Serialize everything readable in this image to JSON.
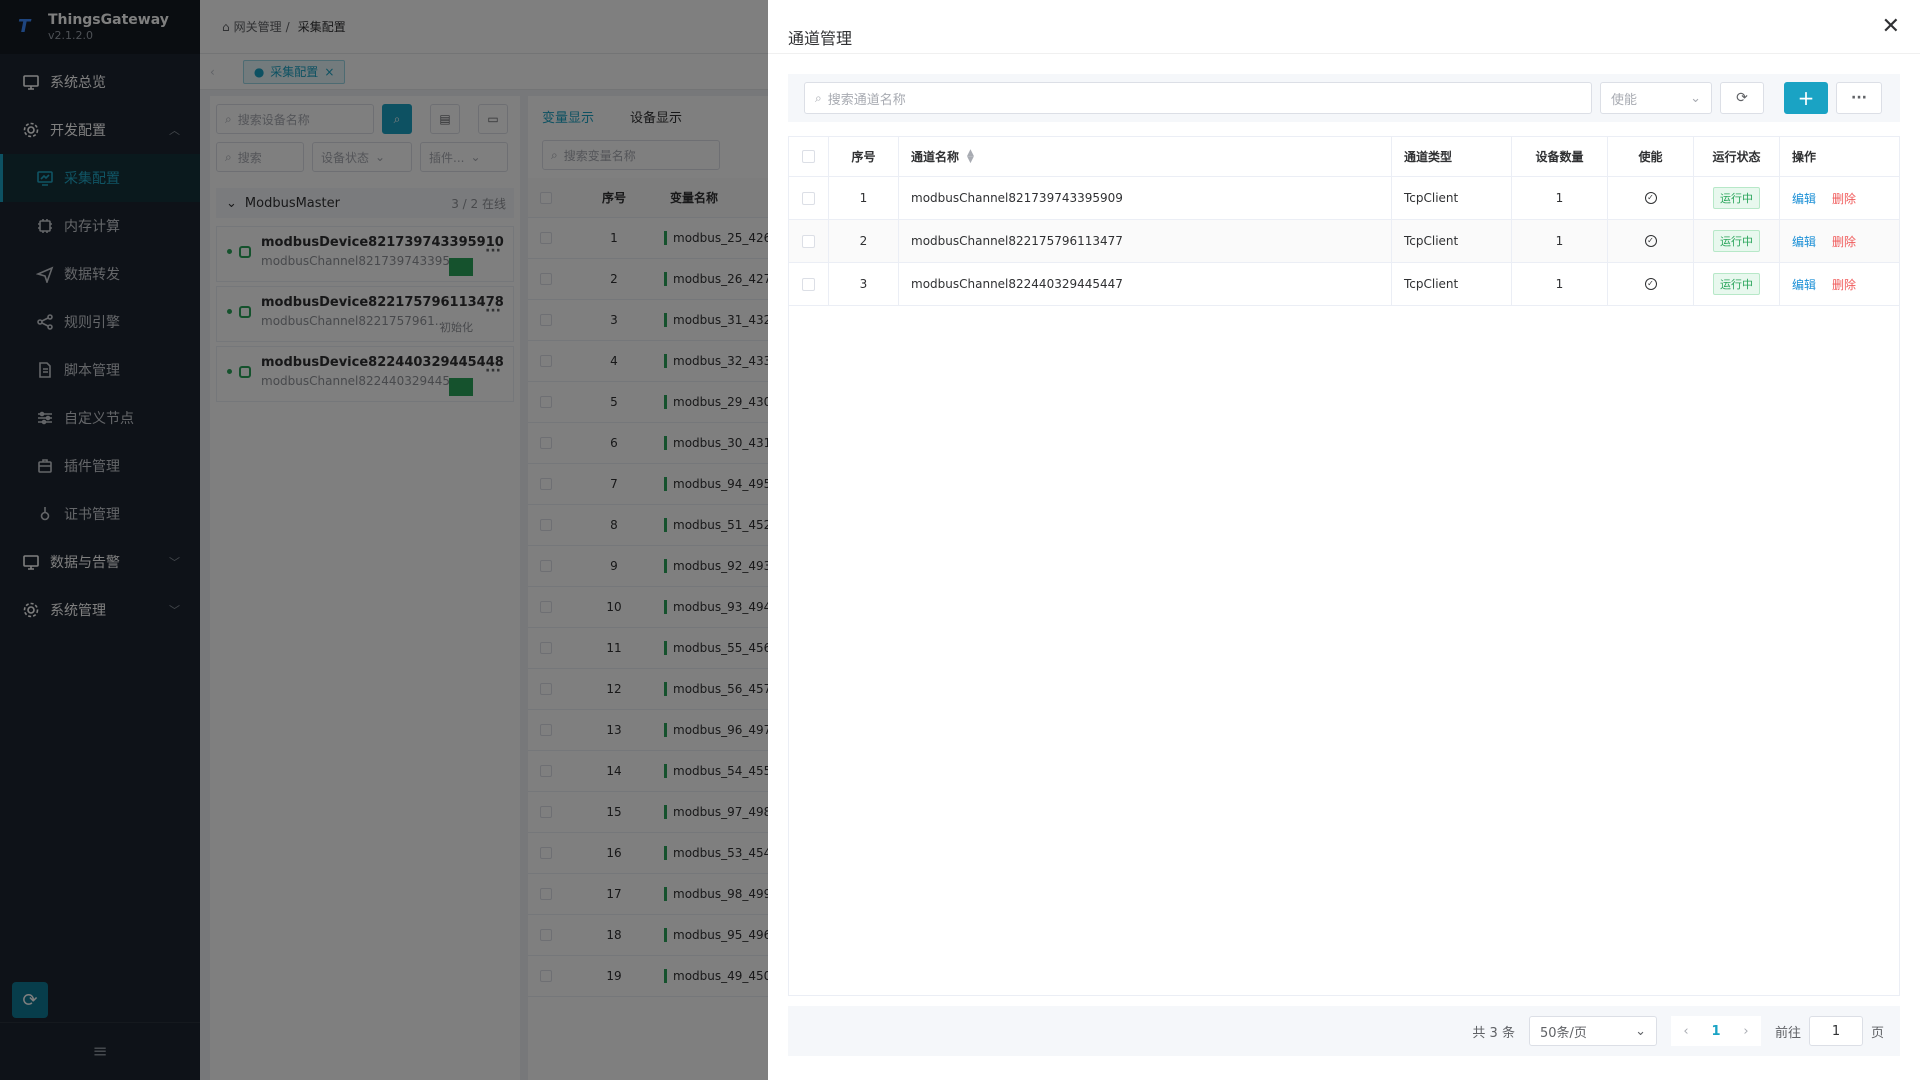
{
  "app": {
    "name": "ThingsGateway",
    "version": "v2.1.2.0"
  },
  "sidebar": {
    "items": [
      {
        "label": "系统总览"
      },
      {
        "label": "开发配置"
      },
      {
        "label": "采集配置"
      },
      {
        "label": "内存计算"
      },
      {
        "label": "数据转发"
      },
      {
        "label": "规则引擎"
      },
      {
        "label": "脚本管理"
      },
      {
        "label": "自定义节点"
      },
      {
        "label": "插件管理"
      },
      {
        "label": "证书管理"
      },
      {
        "label": "数据与告警"
      },
      {
        "label": "系统管理"
      }
    ]
  },
  "breadcrumb": {
    "root": "网关管理",
    "sep": "/",
    "current": "采集配置"
  },
  "tagbar": {
    "tab": "采集配置"
  },
  "left_panel": {
    "device_search_placeholder": "搜索设备名称",
    "search_placeholder": "搜索",
    "status_filter": "设备状态",
    "plugin_filter": "插件...",
    "group": {
      "name": "ModbusMaster",
      "count": "3 / 2 在线"
    },
    "devices": [
      {
        "name": "modbusDevice821739743395910",
        "channel": "modbusChannel821739743395...",
        "state": ""
      },
      {
        "name": "modbusDevice822175796113478",
        "channel": "modbusChannel8221757961...",
        "state": "初始化"
      },
      {
        "name": "modbusDevice822440329445448",
        "channel": "modbusChannel822440329445...",
        "state": ""
      }
    ]
  },
  "right_panel": {
    "tabs": [
      "变量显示",
      "设备显示"
    ],
    "var_search_placeholder": "搜索变量名称",
    "headers": {
      "index": "序号",
      "name": "变量名称"
    },
    "rows": [
      {
        "i": "1",
        "n": "modbus_25_426"
      },
      {
        "i": "2",
        "n": "modbus_26_427"
      },
      {
        "i": "3",
        "n": "modbus_31_432"
      },
      {
        "i": "4",
        "n": "modbus_32_433"
      },
      {
        "i": "5",
        "n": "modbus_29_430"
      },
      {
        "i": "6",
        "n": "modbus_30_431"
      },
      {
        "i": "7",
        "n": "modbus_94_495"
      },
      {
        "i": "8",
        "n": "modbus_51_452"
      },
      {
        "i": "9",
        "n": "modbus_92_493"
      },
      {
        "i": "10",
        "n": "modbus_93_494"
      },
      {
        "i": "11",
        "n": "modbus_55_456"
      },
      {
        "i": "12",
        "n": "modbus_56_457"
      },
      {
        "i": "13",
        "n": "modbus_96_497"
      },
      {
        "i": "14",
        "n": "modbus_54_455"
      },
      {
        "i": "15",
        "n": "modbus_97_498"
      },
      {
        "i": "16",
        "n": "modbus_53_454"
      },
      {
        "i": "17",
        "n": "modbus_98_499"
      },
      {
        "i": "18",
        "n": "modbus_95_496"
      },
      {
        "i": "19",
        "n": "modbus_49_450"
      }
    ]
  },
  "drawer": {
    "title": "通道管理",
    "search_placeholder": "搜索通道名称",
    "enable_select": "使能",
    "table": {
      "headers": {
        "index": "序号",
        "name": "通道名称",
        "type": "通道类型",
        "devices": "设备数量",
        "enable": "使能",
        "status": "运行状态",
        "ops": "操作"
      },
      "rows": [
        {
          "index": "1",
          "name": "modbusChannel821739743395909",
          "type": "TcpClient",
          "devices": "1",
          "status": "运行中",
          "edit": "编辑",
          "delete": "删除"
        },
        {
          "index": "2",
          "name": "modbusChannel822175796113477",
          "type": "TcpClient",
          "devices": "1",
          "status": "运行中",
          "edit": "编辑",
          "delete": "删除"
        },
        {
          "index": "3",
          "name": "modbusChannel822440329445447",
          "type": "TcpClient",
          "devices": "1",
          "status": "运行中",
          "edit": "编辑",
          "delete": "删除"
        }
      ]
    },
    "pagination": {
      "total": "共 3 条",
      "page_size": "50条/页",
      "current": "1",
      "goto_label": "前往",
      "goto_value": "1",
      "page_unit": "页"
    }
  },
  "colors": {
    "accent": "#1aa3c4",
    "sidebar_bg": "#1d2530",
    "running": "#2aa55b",
    "delete": "#f05a5a",
    "edit": "#1a8fd6"
  }
}
